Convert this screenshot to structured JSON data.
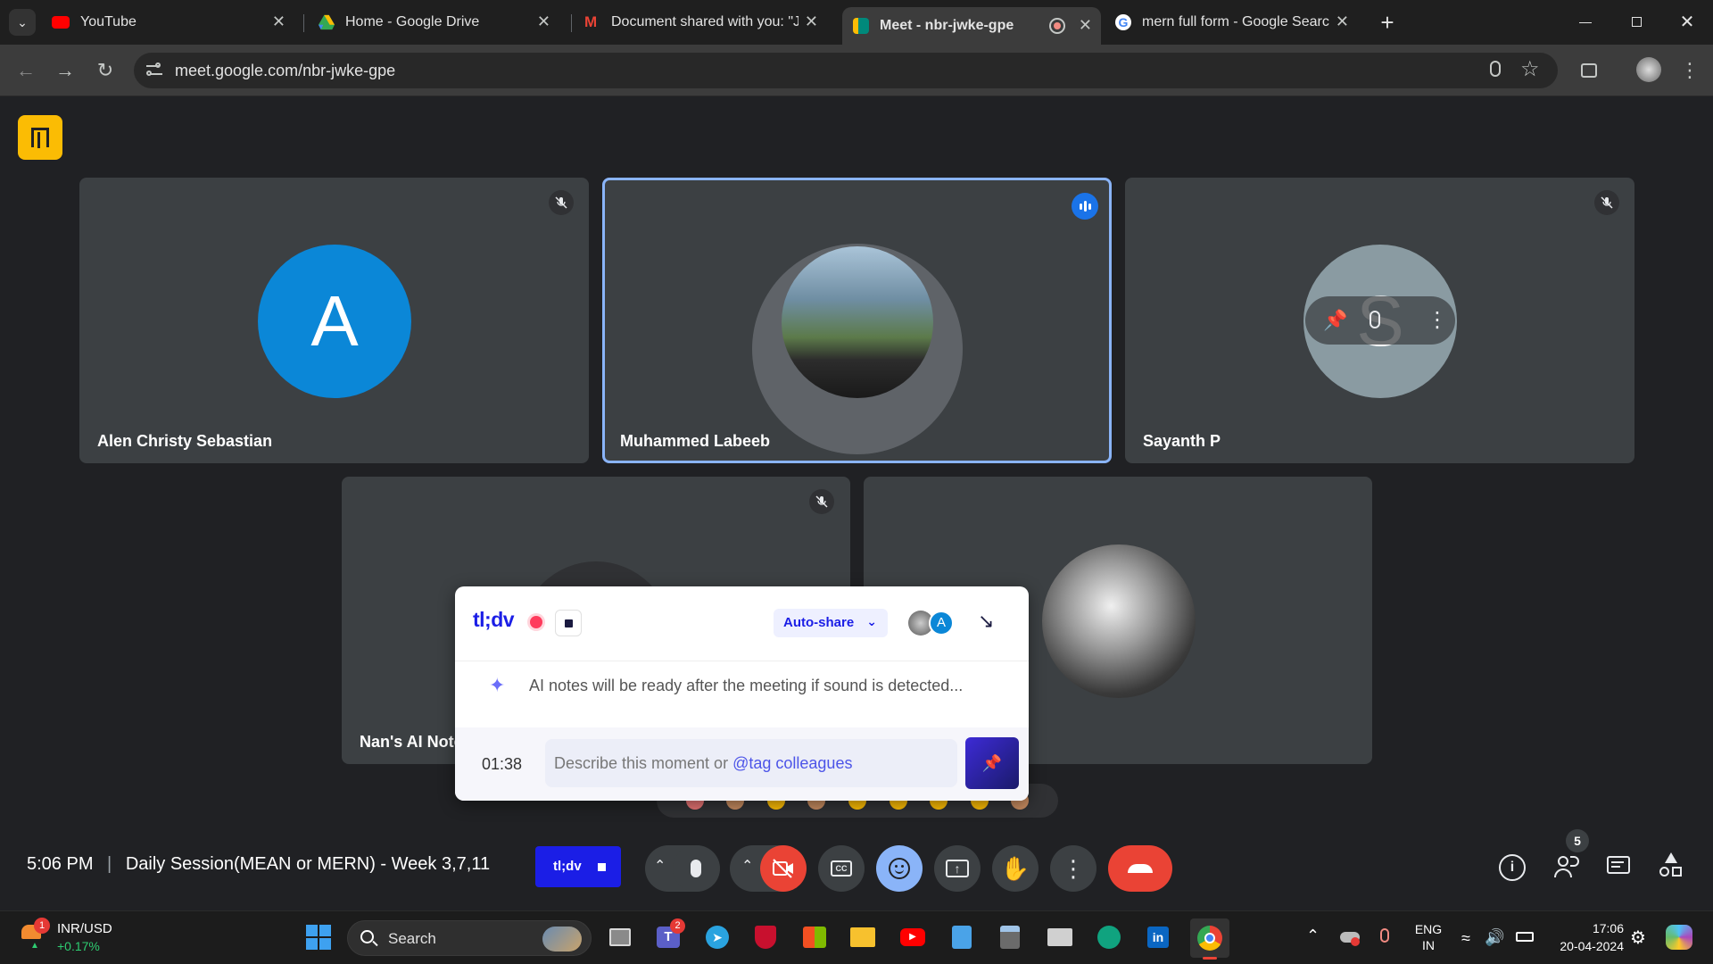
{
  "browser": {
    "tabs": [
      {
        "title": "YouTube",
        "icon": "youtube-icon"
      },
      {
        "title": "Home - Google Drive",
        "icon": "google-drive-icon"
      },
      {
        "title": "Document shared with you: \"Ja",
        "icon": "gmail-icon"
      },
      {
        "title": "Meet - nbr-jwke-gpe",
        "icon": "google-meet-icon"
      },
      {
        "title": "mern full form - Google Search",
        "icon": "google-icon"
      }
    ],
    "url": "meet.google.com/nbr-jwke-gpe"
  },
  "participants": [
    {
      "name": "Alen Christy Sebastian",
      "initial": "A"
    },
    {
      "name": "Muhammed Labeeb"
    },
    {
      "name": "Sayanth P",
      "initial": "S"
    },
    {
      "name": "Nan's AI Note"
    }
  ],
  "tldv": {
    "logo": "tl;dv",
    "autoshare": "Auto-share",
    "ai_note": "AI notes will be ready after the meeting if sound is detected...",
    "timer": "01:38",
    "input_placeholder": "Describe this moment or",
    "input_tag": "@tag colleagues",
    "avatar_initial": "A"
  },
  "bottom": {
    "time": "5:06 PM",
    "separator": "|",
    "meeting_title": "Daily Session(MEAN or MERN) - Week 3,7,11",
    "tldv_button": "tl;dv",
    "people_count": "5"
  },
  "taskbar": {
    "ticker_label": "INR/USD",
    "ticker_change": "+0.17%",
    "ticker_badge": "1",
    "search_label": "Search",
    "teams_badge": "2",
    "lang_1": "ENG",
    "lang_2": "IN",
    "clock_time": "17:06",
    "clock_date": "20-04-2024"
  },
  "colors": {
    "meet_bg": "#202124",
    "tile_bg": "#3c4043",
    "active_border": "#8ab4f8",
    "end_call": "#ea4335",
    "camera_off": "#ea4335",
    "tldv_blue": "#1b1ee6",
    "accent_yellow": "#fbbc04"
  }
}
